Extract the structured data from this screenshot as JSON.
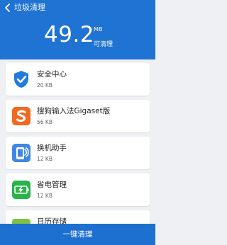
{
  "header": {
    "title": "垃圾清理",
    "size_value": "49.2",
    "size_unit": "MB",
    "size_caption": "可清理"
  },
  "items": [
    {
      "name": "安全中心",
      "size": "20 KB",
      "icon": "shield-check-icon"
    },
    {
      "name": "搜狗输入法Gigaset版",
      "size": "56 KB",
      "icon": "sogou-input-icon"
    },
    {
      "name": "换机助手",
      "size": "12 KB",
      "icon": "phone-transfer-icon"
    },
    {
      "name": "省电管理",
      "size": "12 KB",
      "icon": "battery-charge-icon"
    },
    {
      "name": "日历存储",
      "size": "",
      "icon": "calendar-storage-icon"
    }
  ],
  "bottom": {
    "label": "一键清理"
  },
  "colors": {
    "primary": "#1f73d2",
    "background": "#eef0f3"
  }
}
